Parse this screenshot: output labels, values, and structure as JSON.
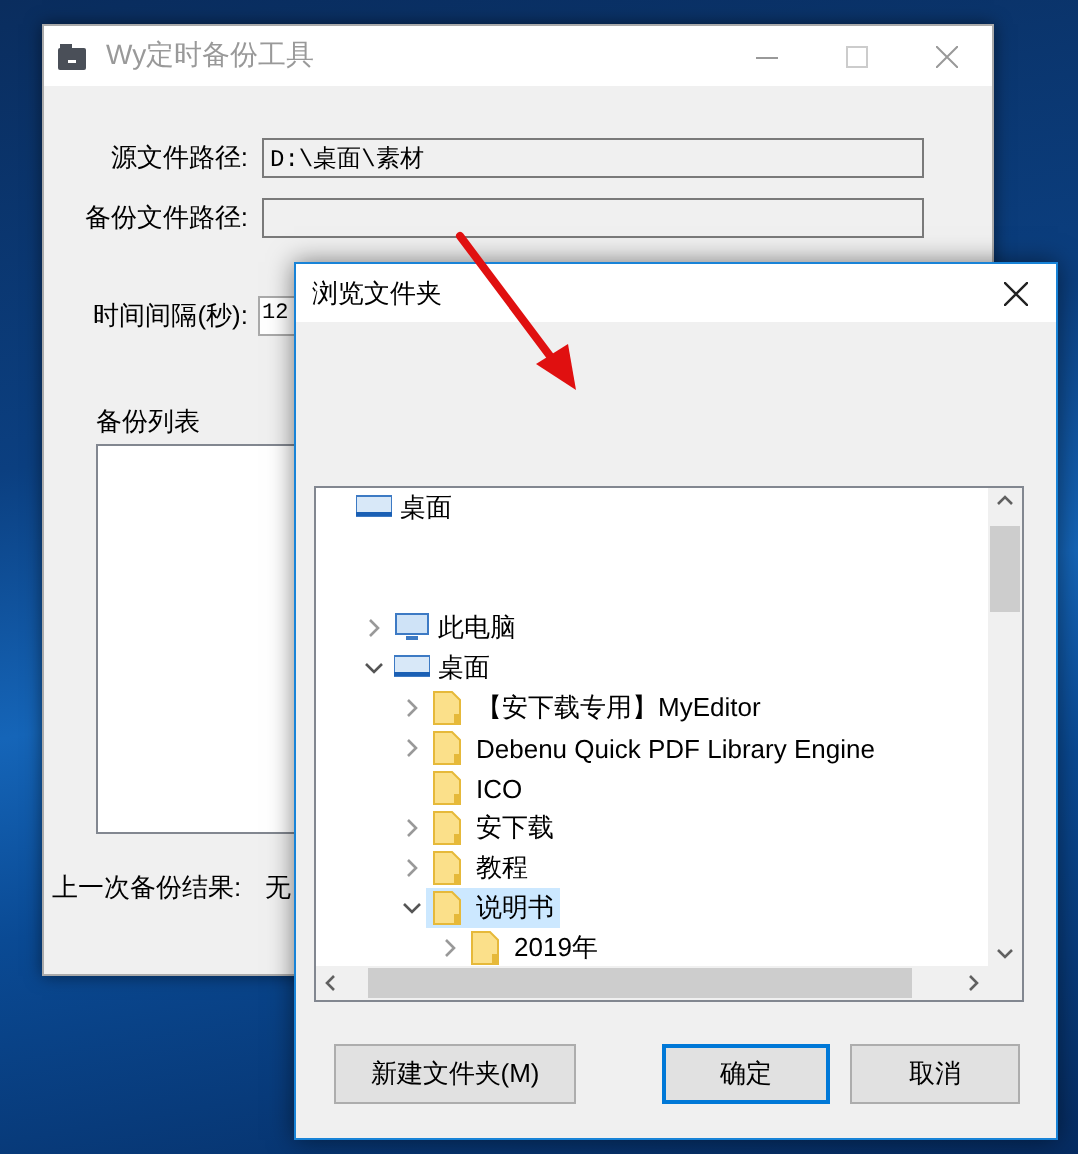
{
  "main_window": {
    "title": "Wy定时备份工具",
    "fields": [
      {
        "label": "源文件路径:",
        "value": "D:\\桌面\\素材"
      },
      {
        "label": "备份文件路径:"
      }
    ],
    "interval": {
      "label": "时间间隔(秒):",
      "value": "12"
    },
    "list_label": "备份列表",
    "result": {
      "label": "上一次备份结果:",
      "value": "无"
    }
  },
  "dialog": {
    "title": "浏览文件夹",
    "tree": [
      {
        "label": "桌面",
        "kind": "desktop",
        "selected": false,
        "children": [
          {
            "label": "此电脑",
            "kind": "computer",
            "selected": false,
            "expanded": false
          },
          {
            "label": "桌面",
            "kind": "desktop",
            "selected": false,
            "expanded": true,
            "children": [
              {
                "label": "【安下载专用】MyEditor",
                "kind": "folder",
                "selected": false,
                "expanded": false
              },
              {
                "label": "Debenu Quick PDF Library Engine",
                "kind": "folder",
                "selected": false,
                "expanded": false
              },
              {
                "label": "ICO",
                "kind": "folder",
                "selected": false
              },
              {
                "label": "安下载",
                "kind": "folder",
                "selected": false,
                "expanded": false
              },
              {
                "label": "教程",
                "kind": "folder",
                "selected": false,
                "expanded": false
              },
              {
                "label": "说明书",
                "kind": "folder",
                "selected": true,
                "expanded": true,
                "children": [
                  {
                    "label": "2019年",
                    "kind": "folder",
                    "selected": false,
                    "expanded": false
                  }
                ]
              }
            ]
          }
        ]
      }
    ],
    "buttons": [
      {
        "label": "新建文件夹(M)",
        "default": false
      },
      {
        "label": "确定",
        "default": true
      },
      {
        "label": "取消",
        "default": false
      }
    ]
  }
}
